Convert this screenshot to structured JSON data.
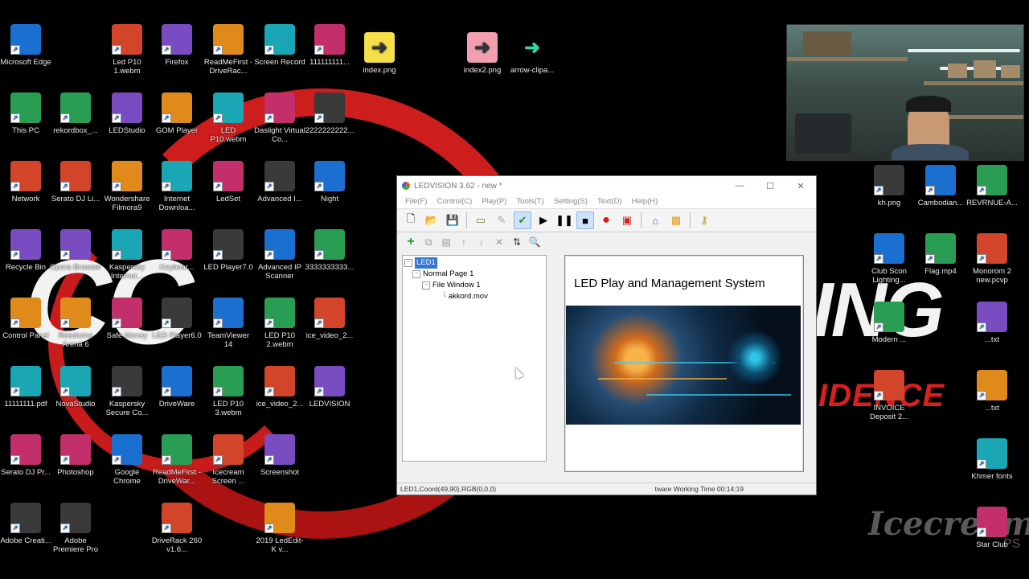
{
  "desktop_icons": {
    "col1": [
      {
        "label": "Microsoft Edge",
        "icon": "edge-icon"
      },
      {
        "label": "This PC",
        "icon": "computer-icon"
      },
      {
        "label": "Network",
        "icon": "network-icon"
      },
      {
        "label": "Recycle Bin",
        "icon": "recycle-bin-icon"
      },
      {
        "label": "Control Panel",
        "icon": "control-panel-icon"
      },
      {
        "label": "11111111.pdf",
        "icon": "pdf-icon"
      },
      {
        "label": "Serato DJ Pr...",
        "icon": "serato-icon"
      },
      {
        "label": "Adobe Creati...",
        "icon": "adobe-cc-icon"
      }
    ],
    "col2": [
      {
        "label": "rekordbox_...",
        "icon": "rekordbox-icon"
      },
      {
        "label": "Serato DJ Li...",
        "icon": "serato-lite-icon"
      },
      {
        "label": "Opera Browser",
        "icon": "opera-icon"
      },
      {
        "label": "Resolume Arena 6",
        "icon": "resolume-icon"
      },
      {
        "label": "NovaStudio",
        "icon": "novastudio-icon"
      },
      {
        "label": "Photoshop",
        "icon": "photoshop-icon"
      },
      {
        "label": "Adobe Premiere Pro",
        "icon": "premiere-icon"
      }
    ],
    "col3": [
      {
        "label": "Led P10 1.webm",
        "icon": "video-file-icon"
      },
      {
        "label": "LEDStudio",
        "icon": "ledstudio-icon"
      },
      {
        "label": "Wondershare Filmora9",
        "icon": "filmora-icon"
      },
      {
        "label": "Kaspersky Internet...",
        "icon": "kaspersky-icon"
      },
      {
        "label": "Safe Money",
        "icon": "safe-money-icon"
      },
      {
        "label": "Kaspersky Secure Co...",
        "icon": "kaspersky-secure-icon"
      },
      {
        "label": "Google Chrome",
        "icon": "chrome-icon"
      }
    ],
    "col4": [
      {
        "label": "Firefox",
        "icon": "firefox-icon"
      },
      {
        "label": "GOM Player",
        "icon": "gom-player-icon"
      },
      {
        "label": "Internet Downloa...",
        "icon": "idm-icon"
      },
      {
        "label": "Keyboar...",
        "icon": "pdf-icon"
      },
      {
        "label": "LED Player6.0",
        "icon": "led-player-icon"
      },
      {
        "label": "DriveWare",
        "icon": "driveware-icon"
      },
      {
        "label": "ReadMeFirst - DriveWar...",
        "icon": "document-icon"
      },
      {
        "label": "DriveRack 260 v1.6...",
        "icon": "driverack-icon"
      }
    ],
    "col5": [
      {
        "label": "ReadMeFirst - DriveRac...",
        "icon": "document-icon"
      },
      {
        "label": "LED P10.webm",
        "icon": "video-file-icon"
      },
      {
        "label": "LedSet",
        "icon": "ledset-icon"
      },
      {
        "label": "LED Player7.0",
        "icon": "led-player-icon"
      },
      {
        "label": "TeamViewer 14",
        "icon": "teamviewer-icon"
      },
      {
        "label": "LED P10 3.webm",
        "icon": "video-file-icon"
      },
      {
        "label": "Icecream Screen ...",
        "icon": "icecream-icon"
      }
    ],
    "col6": [
      {
        "label": "Screen Record",
        "icon": "folder-icon"
      },
      {
        "label": "Daslight Virtual Co...",
        "icon": "daslight-icon"
      },
      {
        "label": "Advanced I...",
        "icon": "advanced-ip-icon"
      },
      {
        "label": "Advanced IP Scanner",
        "icon": "advanced-ip-icon"
      },
      {
        "label": "LED P10 2.webm",
        "icon": "video-file-icon"
      },
      {
        "label": "ice_video_2...",
        "icon": "video-file-icon"
      },
      {
        "label": "Screenshot",
        "icon": "screenshot-icon"
      },
      {
        "label": "2019 LedEdit-K v...",
        "icon": "ledit-icon"
      }
    ],
    "col7": [
      {
        "label": "111111111...",
        "icon": "video-file-icon"
      },
      {
        "label": "2222222222...",
        "icon": "video-file-icon"
      },
      {
        "label": "Night",
        "icon": "folder-icon"
      },
      {
        "label": "3333333333...",
        "icon": "media-file-icon"
      },
      {
        "label": "ice_video_2...",
        "icon": "media-file-icon"
      },
      {
        "label": "LEDVISION",
        "icon": "ledvision-icon"
      }
    ],
    "top_row": [
      {
        "label": "index.png",
        "icon": "arrow-right-icon"
      },
      {
        "label": "index2.png",
        "icon": "arrow-right-icon"
      },
      {
        "label": "arrow-clipa...",
        "icon": "arrow-right-icon"
      }
    ],
    "right_col1": [
      {
        "label": "kh.png",
        "icon": "flag-icon"
      },
      {
        "label": "Club Scon Lighting...",
        "icon": "folder-icon"
      },
      {
        "label": "Modern ...",
        "icon": "document-icon"
      },
      {
        "label": "INVOICE Deposit 2...",
        "icon": "folder-icon"
      }
    ],
    "right_col2": [
      {
        "label": "Cambodian...",
        "icon": "image-file-icon"
      },
      {
        "label": "Flag.mp4",
        "icon": "video-file-icon"
      }
    ],
    "right_col3": [
      {
        "label": "REVRNUE-A...",
        "icon": "excel-icon"
      },
      {
        "label": "Monorom 2 new.pcvp",
        "icon": "document-icon"
      },
      {
        "label": "...txt",
        "icon": "document-icon"
      },
      {
        "label": "...txt",
        "icon": "document-icon"
      },
      {
        "label": "Khmer fonts",
        "icon": "folder-icon"
      },
      {
        "label": "Star Club",
        "icon": "folder-icon"
      }
    ]
  },
  "wallpaper": {
    "left_text": "CC",
    "right_text": "ING",
    "right_sub": "IDENCE",
    "watermark": "Icecream",
    "watermark_sub": "PS"
  },
  "app": {
    "title": "LEDVISION 3.62 - new *",
    "window_controls": {
      "minimize": "—",
      "maximize": "☐",
      "close": "✕"
    },
    "menu": [
      "File(F)",
      "Control(C)",
      "Play(P)",
      "Tools(T)",
      "Setting(S)",
      "Text(D)",
      "Help(H)"
    ],
    "tree": {
      "root": "LED1",
      "page": "Normal Page 1",
      "window": "File Window 1",
      "file": "akkord.mov"
    },
    "preview_title": "LED Play and Management System",
    "status_left": "LED1,Coord(49,90),RGB(0,0,0)",
    "status_right": "tware Working Time 00:14:19"
  },
  "colors": {
    "accent_red": "#d91f1f",
    "selection_blue": "#3476d2"
  }
}
